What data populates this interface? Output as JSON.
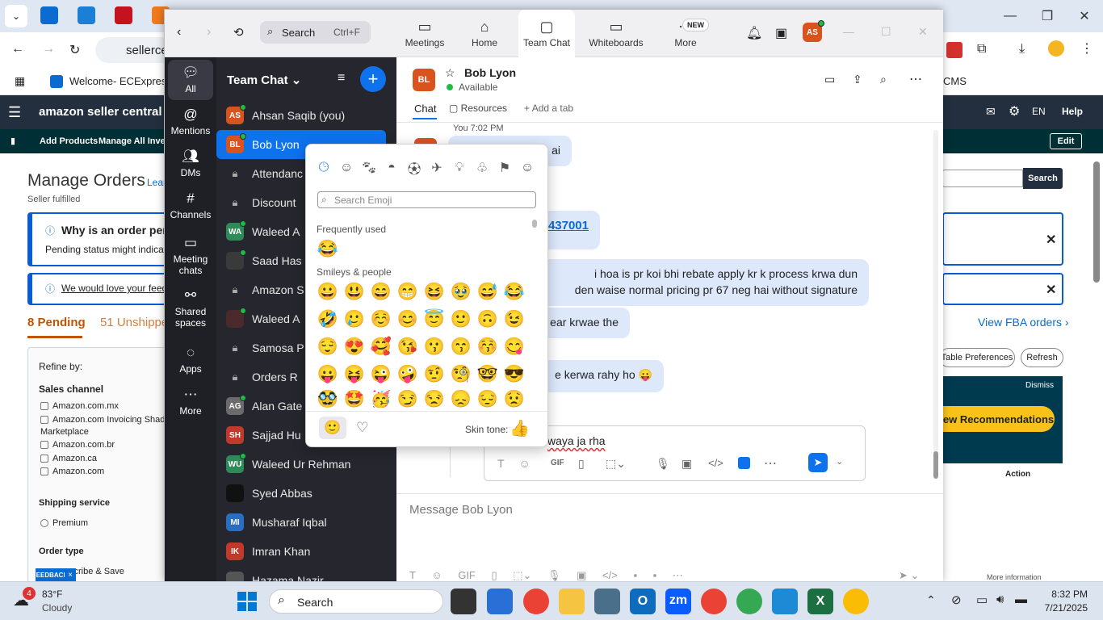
{
  "browser": {
    "address_text": "sellerce",
    "bookmark_label": "Welcome- ECExpres...",
    "bookmark_right": "CMS"
  },
  "amazon": {
    "logo": "amazon seller central",
    "subnav": [
      "Add Products",
      "Manage All Invent"
    ],
    "lang": "EN",
    "help": "Help",
    "edit": "Edit",
    "title": "Manage Orders",
    "learn": "Lear",
    "subtitle": "Seller fulfilled",
    "info_title": "Why is an order pen",
    "info_text": "Pending status might indicate a",
    "feedback_link": "We would love your feedba",
    "tab_pending": "8 Pending",
    "tab_unshipped": "51 Unshippe",
    "search_btn": "Search",
    "view_fba": "View FBA orders",
    "table_prefs": "Table Preferences",
    "refresh": "Refresh",
    "dismiss": "Dismiss",
    "recommend": "ew Recommendations",
    "action_col": "Action",
    "more_info": "More information",
    "refine": "Refine by:",
    "sales_channel": "Sales channel",
    "channels": [
      "Amazon.com.mx",
      "Amazon.com Invoicing Shado",
      "Marketplace",
      "Amazon.com.br",
      "Amazon.ca",
      "Amazon.com"
    ],
    "shipping_service": "Shipping service",
    "premium": "Premium",
    "order_type": "Order type",
    "subscribe": "scribe & Save",
    "feedback_tag": "FEEDBACK"
  },
  "zoom": {
    "search_label": "Search",
    "search_shortcut": "Ctrl+F",
    "tabs": [
      {
        "label": "Meetings"
      },
      {
        "label": "Home"
      },
      {
        "label": "Team Chat"
      },
      {
        "label": "Whiteboards"
      },
      {
        "label": "More"
      }
    ],
    "new_badge": "NEW",
    "user_initials": "AS",
    "rail": [
      "All",
      "Mentions",
      "DMs",
      "Channels",
      "Meeting chats",
      "Shared spaces",
      "Apps",
      "More"
    ],
    "list_title": "Team Chat",
    "contacts": [
      {
        "initials": "AS",
        "name": "Ahsan Saqib (you)",
        "color": "#d9531e"
      },
      {
        "initials": "BL",
        "name": "Bob Lyon",
        "color": "#d9531e"
      },
      {
        "initials": "",
        "name": "Attendanc",
        "lock": true
      },
      {
        "initials": "",
        "name": "Discount",
        "lock": true
      },
      {
        "initials": "WA",
        "name": "Waleed A",
        "color": "#2e8b57"
      },
      {
        "initials": "",
        "name": "Saad Has",
        "color": "#3a3a3a"
      },
      {
        "initials": "",
        "name": "Amazon S",
        "lock": true
      },
      {
        "initials": "",
        "name": "Waleed A",
        "color": "#4a2a2a"
      },
      {
        "initials": "",
        "name": "Samosa P",
        "lock": true
      },
      {
        "initials": "",
        "name": "Orders R",
        "lock": true
      },
      {
        "initials": "AG",
        "name": "Alan Gate",
        "color": "#6b6b6b"
      },
      {
        "initials": "SH",
        "name": "Sajjad Hu",
        "color": "#c0392b"
      },
      {
        "initials": "WU",
        "name": "Waleed Ur Rehman",
        "color": "#2e8b57"
      },
      {
        "initials": "",
        "name": "Syed Abbas",
        "color": "#111"
      },
      {
        "initials": "MI",
        "name": "Musharaf Iqbal",
        "color": "#2a6fbf"
      },
      {
        "initials": "IK",
        "name": "Imran Khan",
        "color": "#c0392b"
      },
      {
        "initials": "",
        "name": "Hazama Nazir",
        "color": "#555"
      }
    ],
    "chat_header": {
      "initials": "BL",
      "name": "Bob Lyon",
      "status": "Available"
    },
    "chat_tabs": [
      "Chat",
      "Resources",
      "Add a tab"
    ],
    "messages": [
      {
        "meta": "You 7:02 PM",
        "text": "ai"
      },
      {
        "text": "437001"
      },
      {
        "text": "i hoa is pr koi bhi rebate apply kr k process krwa dun"
      },
      {
        "text": "den waise normal pricing pr 67 neg hai without signature"
      },
      {
        "text": "ear krwae the"
      },
      {
        "text": "e kerwa rahy ho 😛"
      }
    ],
    "reply_text": "waya ja rha",
    "composer_placeholder": "Message Bob Lyon"
  },
  "emoji_picker": {
    "search_placeholder": "Search Emoji",
    "frequently_used_label": "Frequently used",
    "frequent": [
      "😂"
    ],
    "smileys_label": "Smileys & people",
    "smileys": [
      "😀",
      "😃",
      "😄",
      "😁",
      "😆",
      "🥹",
      "😅",
      "😂",
      "🤣",
      "🥲",
      "☺️",
      "😊",
      "😇",
      "🙂",
      "🙃",
      "😉",
      "😌",
      "😍",
      "🥰",
      "😘",
      "😗",
      "😙",
      "😚",
      "😋",
      "😛",
      "😝",
      "😜",
      "🤪",
      "🤨",
      "🧐",
      "🤓",
      "😎",
      "🥸",
      "🤩",
      "🥳",
      "😏",
      "😒",
      "😞",
      "😔",
      "😟"
    ],
    "skin_tone_label": "Skin tone:",
    "skin_tone_emoji": "👍"
  },
  "taskbar": {
    "temperature": "83°F",
    "weather": "Cloudy",
    "weather_badge": "4",
    "search_label": "Search",
    "time": "8:32 PM",
    "date": "7/21/2025"
  }
}
